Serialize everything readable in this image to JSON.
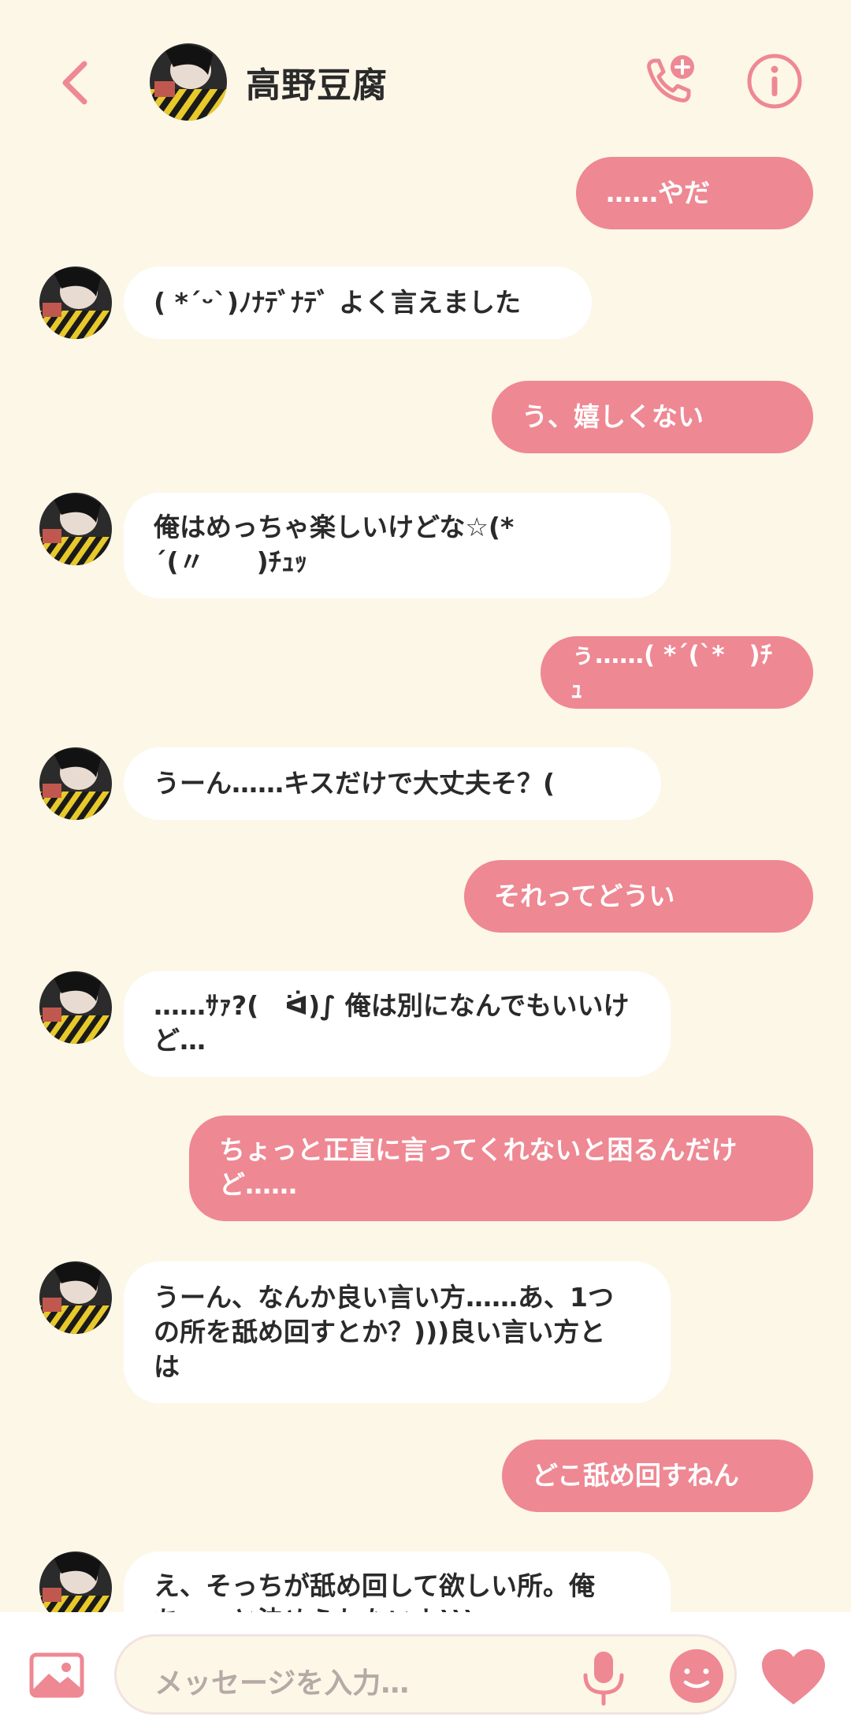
{
  "header": {
    "contact_name": "高野豆腐",
    "icons": {
      "back": "chevron-left-icon",
      "call": "add-call-icon",
      "info": "info-icon"
    }
  },
  "messages": [
    {
      "side": "out",
      "text": "……やだ"
    },
    {
      "side": "in",
      "text": "( *´ᵕ`)ﾉﾅﾃﾞﾅﾃﾞ よく言えました"
    },
    {
      "side": "out",
      "text": "う、嬉しくない"
    },
    {
      "side": "in",
      "lines": [
        "俺はめっちゃ楽しいけどな☆(*",
        "´(〃　　)ﾁｭｯ"
      ]
    },
    {
      "side": "out",
      "text": "ぅ……( *´(`*　)ﾁｭ"
    },
    {
      "side": "in",
      "text": "うーん……キスだけで大丈夫そ？("
    },
    {
      "side": "out",
      "text": "それってどうい"
    },
    {
      "side": "in",
      "lines": [
        "……ｻｧ?(　ᐛ)∫ 俺は別になんでもいいけ",
        "ど…"
      ]
    },
    {
      "side": "out",
      "lines": [
        "ちょっと正直に言ってくれないと困るんだけ",
        "ど……"
      ]
    },
    {
      "side": "in",
      "lines": [
        "うーん、なんか良い言い方……あ、1つ",
        "の所を舐め回すとか？)))良い言い方と",
        "は"
      ]
    },
    {
      "side": "out",
      "text": "どこ舐め回すねん"
    },
    {
      "side": "in",
      "lines": [
        "え、そっちが舐め回して欲しい所。俺",
        "ちょっと決められないよ)))"
      ]
    }
  ],
  "input": {
    "placeholder": "メッセージを入力…"
  },
  "bottom_icons": {
    "image": "image-icon",
    "mic": "mic-icon",
    "emoji": "smile-icon",
    "like": "heart-icon"
  },
  "colors": {
    "accent": "#ee8893",
    "background": "#fdf7e8",
    "incoming_bubble": "#ffffff"
  }
}
